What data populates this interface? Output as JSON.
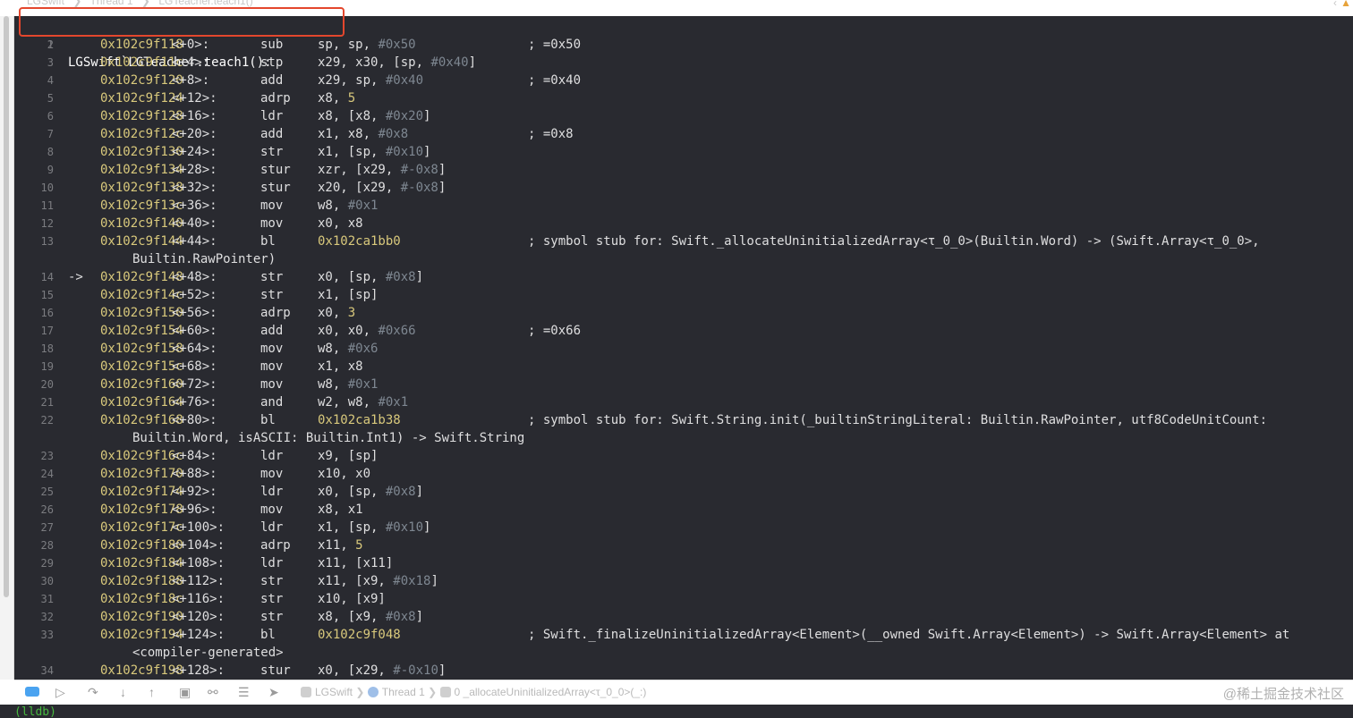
{
  "topbar": {
    "crumbs": [
      "LGSwift",
      "Thread 1",
      "LGTeacher.teach1()"
    ]
  },
  "header_line": {
    "num": "1",
    "text": "LGSwift`LGTeacher.teach1():"
  },
  "rows": [
    {
      "num": "2",
      "addr": "0x102c9f118",
      "off": "<+0>:",
      "mn": "sub",
      "ops": [
        [
          "sp, sp, ",
          "t"
        ],
        [
          "#0x50",
          "i"
        ]
      ],
      "cmt": "; =0x50"
    },
    {
      "num": "3",
      "addr": "0x102c9f11c",
      "off": "<+4>:",
      "mn": "stp",
      "ops": [
        [
          "x29, x30, [sp, ",
          "t"
        ],
        [
          "#0x40",
          "i"
        ],
        [
          "]",
          "t"
        ]
      ],
      "cmt": ""
    },
    {
      "num": "4",
      "addr": "0x102c9f120",
      "off": "<+8>:",
      "mn": "add",
      "ops": [
        [
          "x29, sp, ",
          "t"
        ],
        [
          "#0x40",
          "i"
        ]
      ],
      "cmt": "; =0x40"
    },
    {
      "num": "5",
      "addr": "0x102c9f124",
      "off": "<+12>:",
      "mn": "adrp",
      "ops": [
        [
          "x8, ",
          "t"
        ],
        [
          "5",
          "n"
        ]
      ],
      "cmt": ""
    },
    {
      "num": "6",
      "addr": "0x102c9f128",
      "off": "<+16>:",
      "mn": "ldr",
      "ops": [
        [
          "x8, [x8, ",
          "t"
        ],
        [
          "#0x20",
          "i"
        ],
        [
          "]",
          "t"
        ]
      ],
      "cmt": ""
    },
    {
      "num": "7",
      "addr": "0x102c9f12c",
      "off": "<+20>:",
      "mn": "add",
      "ops": [
        [
          "x1, x8, ",
          "t"
        ],
        [
          "#0x8",
          "i"
        ]
      ],
      "cmt": "; =0x8"
    },
    {
      "num": "8",
      "addr": "0x102c9f130",
      "off": "<+24>:",
      "mn": "str",
      "ops": [
        [
          "x1, [sp, ",
          "t"
        ],
        [
          "#0x10",
          "i"
        ],
        [
          "]",
          "t"
        ]
      ],
      "cmt": ""
    },
    {
      "num": "9",
      "addr": "0x102c9f134",
      "off": "<+28>:",
      "mn": "stur",
      "ops": [
        [
          "xzr, [x29, ",
          "t"
        ],
        [
          "#-0x8",
          "i"
        ],
        [
          "]",
          "t"
        ]
      ],
      "cmt": ""
    },
    {
      "num": "10",
      "addr": "0x102c9f138",
      "off": "<+32>:",
      "mn": "stur",
      "ops": [
        [
          "x20, [x29, ",
          "t"
        ],
        [
          "#-0x8",
          "i"
        ],
        [
          "]",
          "t"
        ]
      ],
      "cmt": ""
    },
    {
      "num": "11",
      "addr": "0x102c9f13c",
      "off": "<+36>:",
      "mn": "mov",
      "ops": [
        [
          "w8, ",
          "t"
        ],
        [
          "#0x1",
          "i"
        ]
      ],
      "cmt": ""
    },
    {
      "num": "12",
      "addr": "0x102c9f140",
      "off": "<+40>:",
      "mn": "mov",
      "ops": [
        [
          "x0, x8",
          "t"
        ]
      ],
      "cmt": ""
    },
    {
      "num": "13",
      "addr": "0x102c9f144",
      "off": "<+44>:",
      "mn": "bl",
      "ops": [
        [
          "0x102ca1bb0",
          "n"
        ]
      ],
      "cmt": "; symbol stub for: Swift._allocateUninitializedArray<τ_0_0>(Builtin.Word) -> (Swift.Array<τ_0_0>,",
      "cont": "Builtin.RawPointer)"
    },
    {
      "num": "14",
      "arrow": "->",
      "addr": "0x102c9f148",
      "off": "<+48>:",
      "mn": "str",
      "ops": [
        [
          "x0, [sp, ",
          "t"
        ],
        [
          "#0x8",
          "i"
        ],
        [
          "]",
          "t"
        ]
      ],
      "cmt": ""
    },
    {
      "num": "15",
      "addr": "0x102c9f14c",
      "off": "<+52>:",
      "mn": "str",
      "ops": [
        [
          "x1, [sp]",
          "t"
        ]
      ],
      "cmt": ""
    },
    {
      "num": "16",
      "addr": "0x102c9f150",
      "off": "<+56>:",
      "mn": "adrp",
      "ops": [
        [
          "x0, ",
          "t"
        ],
        [
          "3",
          "n"
        ]
      ],
      "cmt": ""
    },
    {
      "num": "17",
      "addr": "0x102c9f154",
      "off": "<+60>:",
      "mn": "add",
      "ops": [
        [
          "x0, x0, ",
          "t"
        ],
        [
          "#0x66",
          "i"
        ]
      ],
      "cmt": "; =0x66"
    },
    {
      "num": "18",
      "addr": "0x102c9f158",
      "off": "<+64>:",
      "mn": "mov",
      "ops": [
        [
          "w8, ",
          "t"
        ],
        [
          "#0x6",
          "i"
        ]
      ],
      "cmt": ""
    },
    {
      "num": "19",
      "addr": "0x102c9f15c",
      "off": "<+68>:",
      "mn": "mov",
      "ops": [
        [
          "x1, x8",
          "t"
        ]
      ],
      "cmt": ""
    },
    {
      "num": "20",
      "addr": "0x102c9f160",
      "off": "<+72>:",
      "mn": "mov",
      "ops": [
        [
          "w8, ",
          "t"
        ],
        [
          "#0x1",
          "i"
        ]
      ],
      "cmt": ""
    },
    {
      "num": "21",
      "addr": "0x102c9f164",
      "off": "<+76>:",
      "mn": "and",
      "ops": [
        [
          "w2, w8, ",
          "t"
        ],
        [
          "#0x1",
          "i"
        ]
      ],
      "cmt": ""
    },
    {
      "num": "22",
      "addr": "0x102c9f168",
      "off": "<+80>:",
      "mn": "bl",
      "ops": [
        [
          "0x102ca1b38",
          "n"
        ]
      ],
      "cmt": "; symbol stub for: Swift.String.init(_builtinStringLiteral: Builtin.RawPointer, utf8CodeUnitCount:",
      "cont": "Builtin.Word, isASCII: Builtin.Int1) -> Swift.String"
    },
    {
      "num": "23",
      "addr": "0x102c9f16c",
      "off": "<+84>:",
      "mn": "ldr",
      "ops": [
        [
          "x9, [sp]",
          "t"
        ]
      ],
      "cmt": ""
    },
    {
      "num": "24",
      "addr": "0x102c9f170",
      "off": "<+88>:",
      "mn": "mov",
      "ops": [
        [
          "x10, x0",
          "t"
        ]
      ],
      "cmt": ""
    },
    {
      "num": "25",
      "addr": "0x102c9f174",
      "off": "<+92>:",
      "mn": "ldr",
      "ops": [
        [
          "x0, [sp, ",
          "t"
        ],
        [
          "#0x8",
          "i"
        ],
        [
          "]",
          "t"
        ]
      ],
      "cmt": ""
    },
    {
      "num": "26",
      "addr": "0x102c9f178",
      "off": "<+96>:",
      "mn": "mov",
      "ops": [
        [
          "x8, x1",
          "t"
        ]
      ],
      "cmt": ""
    },
    {
      "num": "27",
      "addr": "0x102c9f17c",
      "off": "<+100>:",
      "mn": "ldr",
      "ops": [
        [
          "x1, [sp, ",
          "t"
        ],
        [
          "#0x10",
          "i"
        ],
        [
          "]",
          "t"
        ]
      ],
      "cmt": ""
    },
    {
      "num": "28",
      "addr": "0x102c9f180",
      "off": "<+104>:",
      "mn": "adrp",
      "ops": [
        [
          "x11, ",
          "t"
        ],
        [
          "5",
          "n"
        ]
      ],
      "cmt": ""
    },
    {
      "num": "29",
      "addr": "0x102c9f184",
      "off": "<+108>:",
      "mn": "ldr",
      "ops": [
        [
          "x11, [x11]",
          "t"
        ]
      ],
      "cmt": ""
    },
    {
      "num": "30",
      "addr": "0x102c9f188",
      "off": "<+112>:",
      "mn": "str",
      "ops": [
        [
          "x11, [x9, ",
          "t"
        ],
        [
          "#0x18",
          "i"
        ],
        [
          "]",
          "t"
        ]
      ],
      "cmt": ""
    },
    {
      "num": "31",
      "addr": "0x102c9f18c",
      "off": "<+116>:",
      "mn": "str",
      "ops": [
        [
          "x10, [x9]",
          "t"
        ]
      ],
      "cmt": ""
    },
    {
      "num": "32",
      "addr": "0x102c9f190",
      "off": "<+120>:",
      "mn": "str",
      "ops": [
        [
          "x8, [x9, ",
          "t"
        ],
        [
          "#0x8",
          "i"
        ],
        [
          "]",
          "t"
        ]
      ],
      "cmt": ""
    },
    {
      "num": "33",
      "addr": "0x102c9f194",
      "off": "<+124>:",
      "mn": "bl",
      "ops": [
        [
          "0x102c9f048",
          "n"
        ]
      ],
      "cmt": "; Swift._finalizeUninitializedArray<Element>(__owned Swift.Array<Element>) -> Swift.Array<Element> at",
      "cont": "<compiler-generated>"
    },
    {
      "num": "34",
      "addr": "0x102c9f198",
      "off": "<+128>:",
      "mn": "stur",
      "ops": [
        [
          "x0, [x29, ",
          "t"
        ],
        [
          "#-0x10",
          "i"
        ],
        [
          "]",
          "t"
        ]
      ],
      "cmt": ""
    }
  ],
  "debugbar": {
    "project": "LGSwift",
    "thread": "Thread 1",
    "frame": "0 _allocateUninitializedArray<τ_0_0>(_:)",
    "watermark": "@稀土掘金技术社区"
  },
  "console": {
    "prompt": "(lldb)"
  },
  "colors": {
    "editor_bg": "#292a30",
    "address": "#d9c97c",
    "immediate": "#7e8791",
    "text": "#dfdfe0",
    "highlight_border": "#e4472d",
    "prompt": "#46b83e"
  }
}
